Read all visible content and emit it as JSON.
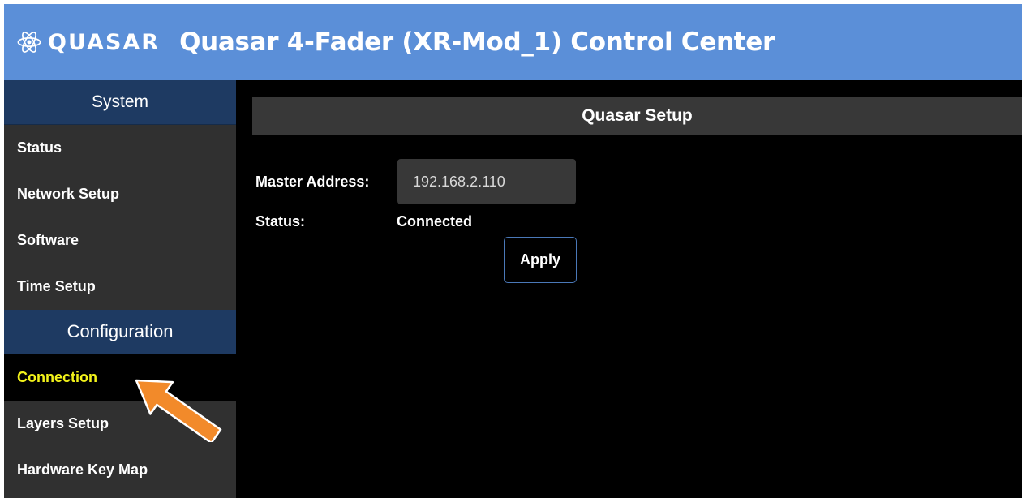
{
  "header": {
    "brand": "QUASAR",
    "title": "Quasar 4-Fader (XR-Mod_1) Control Center",
    "color": "#5b8fd8"
  },
  "sidebar": {
    "sections": [
      {
        "title": "System",
        "items": [
          "Status",
          "Network Setup",
          "Software",
          "Time Setup"
        ]
      },
      {
        "title": "Configuration",
        "items": [
          "Connection",
          "Layers Setup",
          "Hardware Key Map"
        ]
      }
    ],
    "active_item": "Connection",
    "active_color": "#f2f21a"
  },
  "panel": {
    "title": "Quasar Setup",
    "master_address_label": "Master Address:",
    "master_address_value": "192.168.2.110",
    "status_label": "Status:",
    "status_value": "Connected",
    "apply_label": "Apply"
  },
  "annotation": {
    "arrow_color": "#f28a2a",
    "arrow_icon": "pointer-arrow-icon"
  }
}
